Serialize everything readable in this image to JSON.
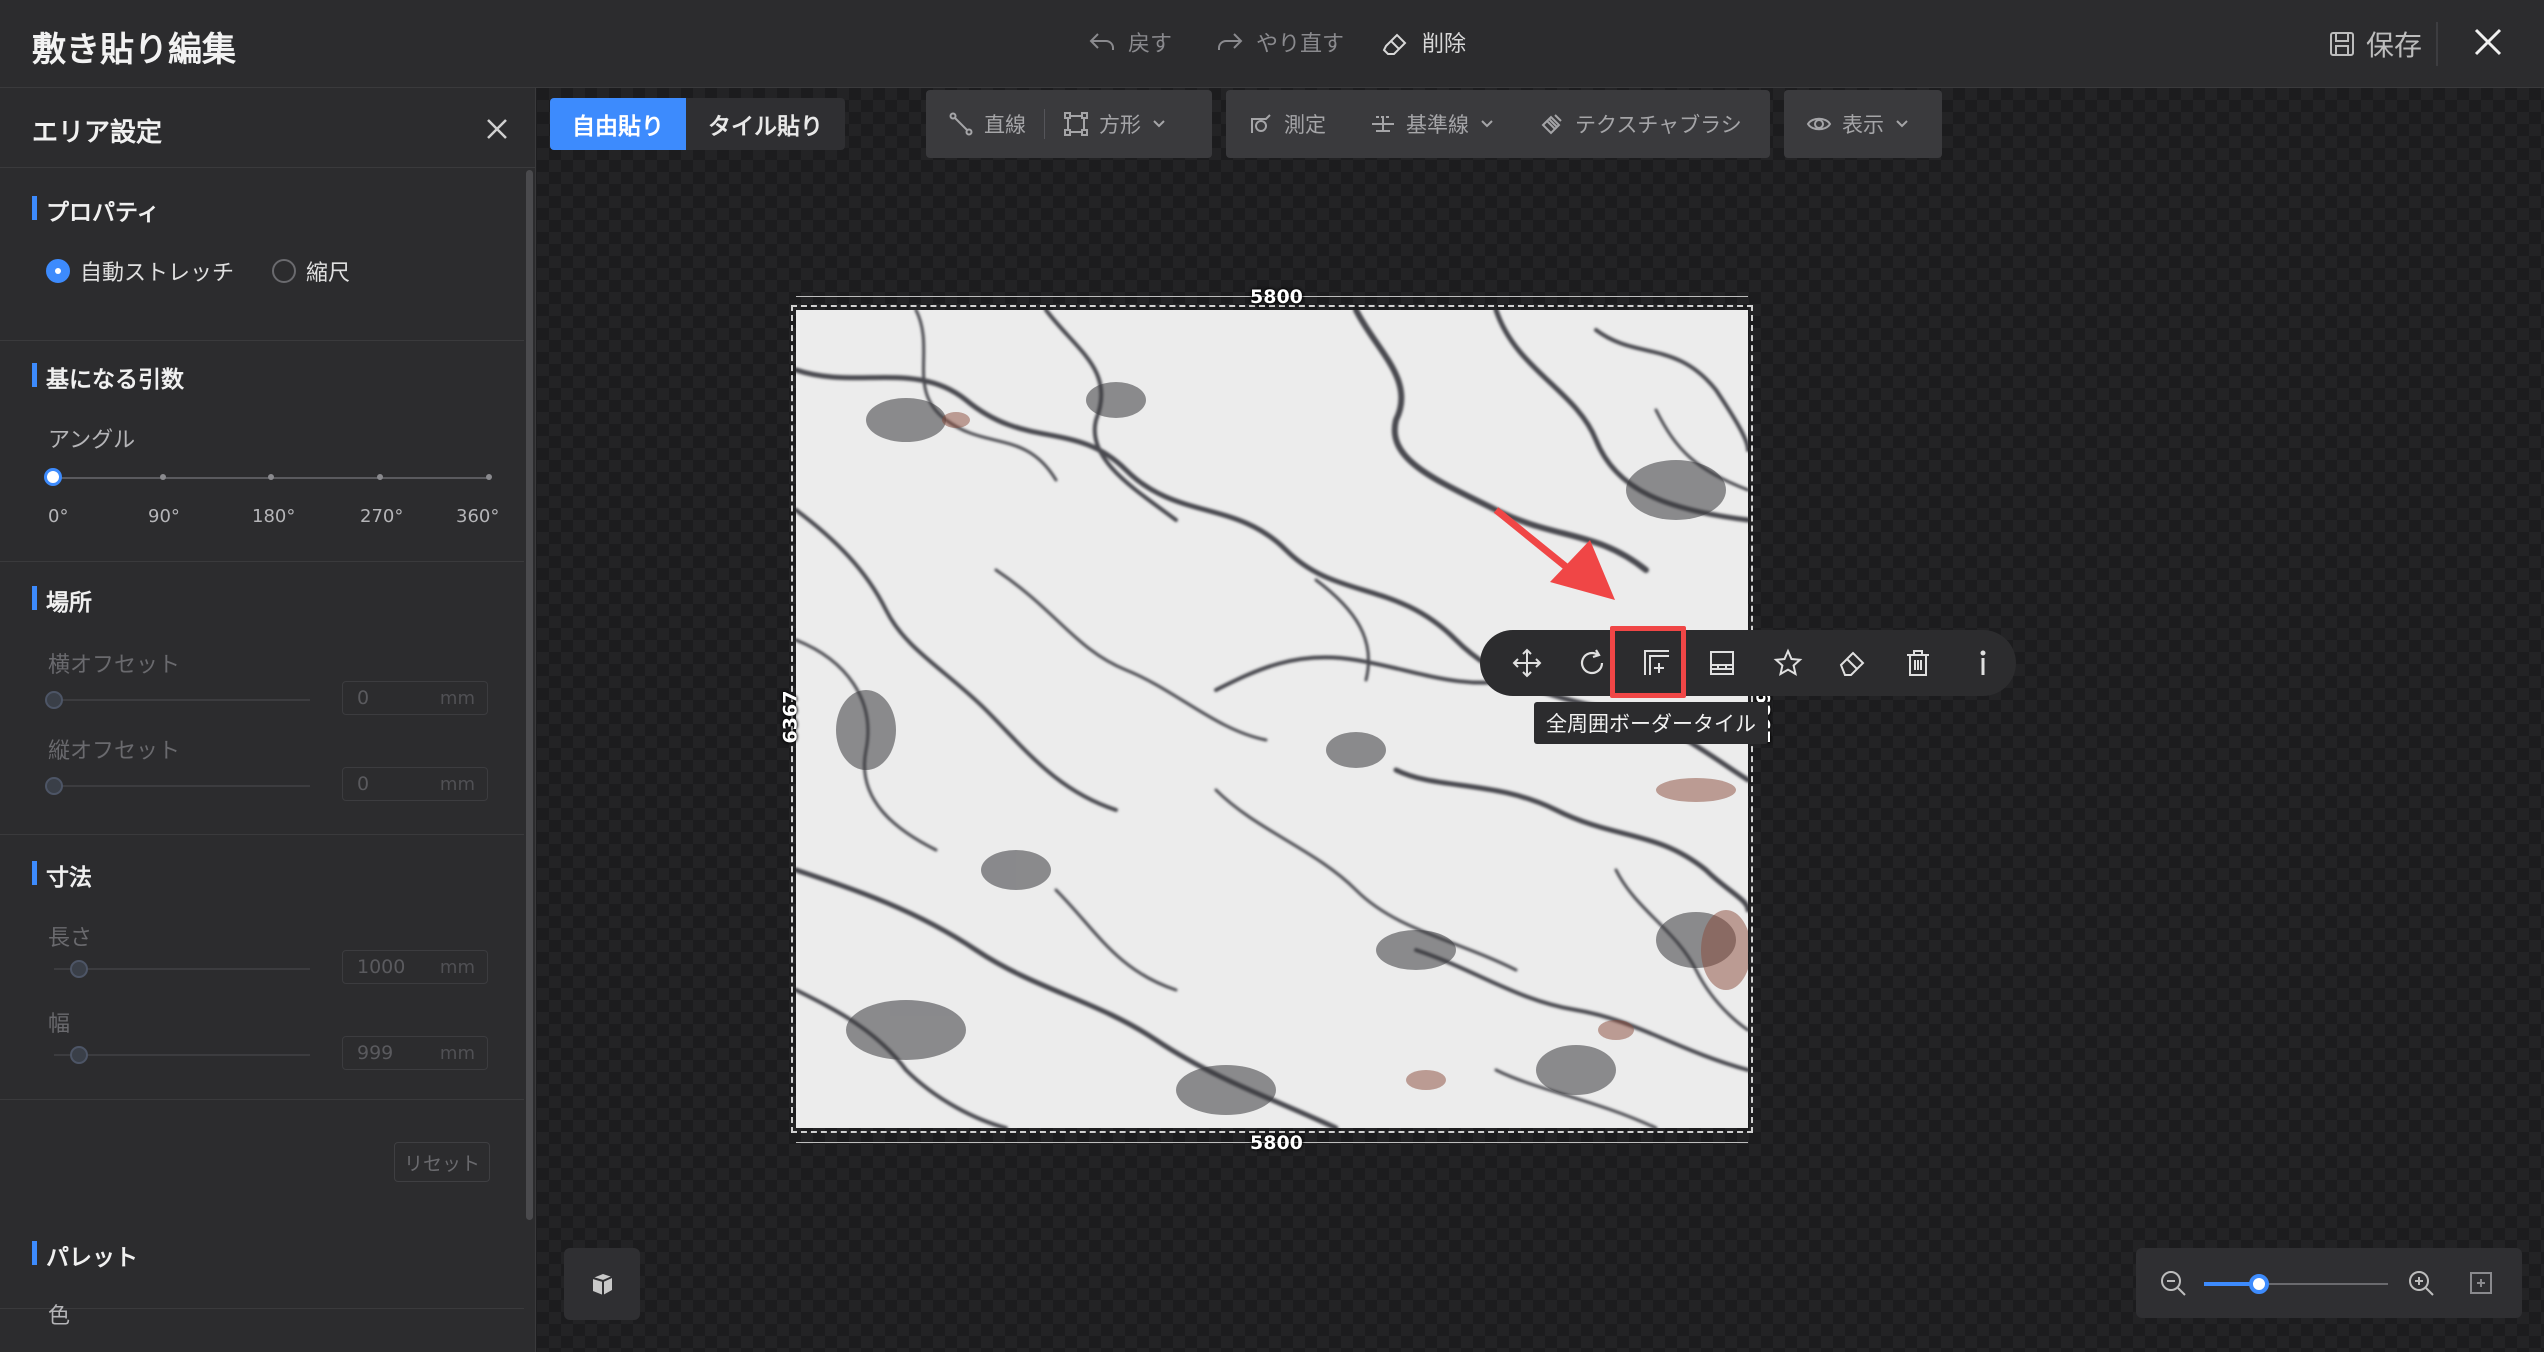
{
  "titlebar": {
    "title": "敷き貼り編集",
    "undo": "戻す",
    "redo": "やり直す",
    "delete": "削除",
    "save": "保存"
  },
  "panel": {
    "title": "エリア設定",
    "property": {
      "title": "プロパティ",
      "options": [
        "自動ストレッチ",
        "縮尺"
      ],
      "selected": "自動ストレッチ"
    },
    "params": {
      "title": "基になる引数",
      "angle_label": "アングル",
      "angle_value": 0,
      "ticks": [
        "0°",
        "90°",
        "180°",
        "270°",
        "360°"
      ]
    },
    "location": {
      "title": "場所",
      "h_offset_label": "横オフセット",
      "h_offset_value": "0",
      "v_offset_label": "縦オフセット",
      "v_offset_value": "0",
      "unit": "mm"
    },
    "size": {
      "title": "寸法",
      "length_label": "長さ",
      "length_value": "1000",
      "width_label": "幅",
      "width_value": "999",
      "unit": "mm"
    },
    "reset": "リセット",
    "palette": {
      "title": "パレット",
      "color_label": "色"
    }
  },
  "canvas": {
    "modes": [
      "自由貼り",
      "タイル貼り"
    ],
    "active_mode": "自由貼り",
    "tools": {
      "line": "直線",
      "rect": "方形",
      "measure": "測定",
      "baseline": "基準線",
      "texture_brush": "テクスチャブラシ",
      "view": "表示"
    },
    "dimensions": {
      "top": "5800",
      "bottom": "5800",
      "left": "6367",
      "right": "6367"
    },
    "tooltip": "全周囲ボーダータイル",
    "zoom_level": 0.3
  },
  "icons": {
    "ctx": [
      "move-icon",
      "rotate-icon",
      "border-tile-icon",
      "tile-row-icon",
      "star-icon",
      "eraser-icon",
      "trash-icon",
      "info-icon"
    ]
  },
  "colors": {
    "accent": "#3d8bfd",
    "highlight": "#f04646",
    "panel": "#2c2c2e"
  }
}
